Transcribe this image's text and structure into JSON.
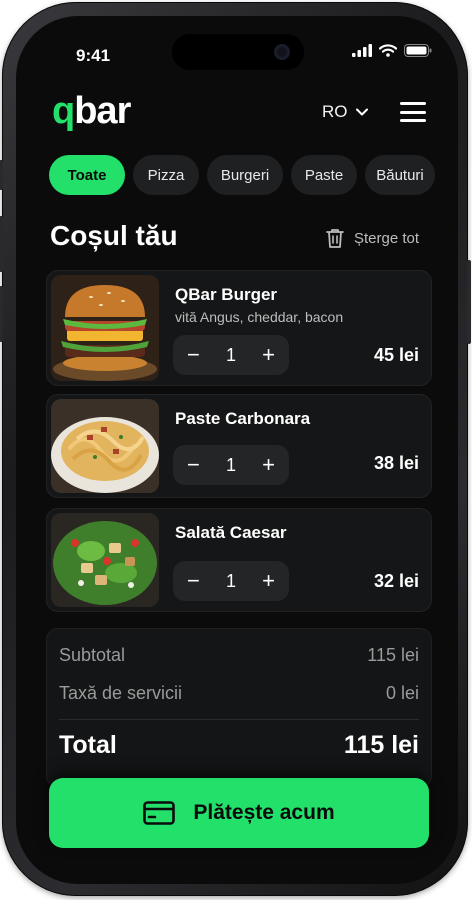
{
  "status": {
    "time": "9:41"
  },
  "header": {
    "logo_q": "q",
    "logo_rest": "bar",
    "language": "RO"
  },
  "categories": [
    {
      "label": "Toate",
      "active": true
    },
    {
      "label": "Pizza",
      "active": false
    },
    {
      "label": "Burgeri",
      "active": false
    },
    {
      "label": "Paste",
      "active": false
    },
    {
      "label": "Băuturi",
      "active": false
    }
  ],
  "cart": {
    "title": "Coșul tău",
    "clear_label": "Șterge tot",
    "items": [
      {
        "name": "QBar Burger",
        "description": "vită Angus, cheddar, bacon",
        "quantity": "1",
        "price": "45 lei",
        "image": "burger-photo"
      },
      {
        "name": "Paste Carbonara",
        "quantity": "1",
        "price": "38 lei",
        "image": "pasta-photo"
      },
      {
        "name": "Salată Caesar",
        "quantity": "1",
        "price": "32 lei",
        "image": "salad-photo"
      }
    ]
  },
  "summary": {
    "subtotal_label": "Subtotal",
    "subtotal_value": "115 lei",
    "service_label": "Taxă de servicii",
    "service_value": "0 lei",
    "total_label": "Total",
    "total_value": "115 lei"
  },
  "pay": {
    "label": "Plătește acum",
    "icon": "card-icon"
  },
  "colors": {
    "accent": "#22e06a",
    "background": "#0b0b0c",
    "card": "#151617"
  }
}
